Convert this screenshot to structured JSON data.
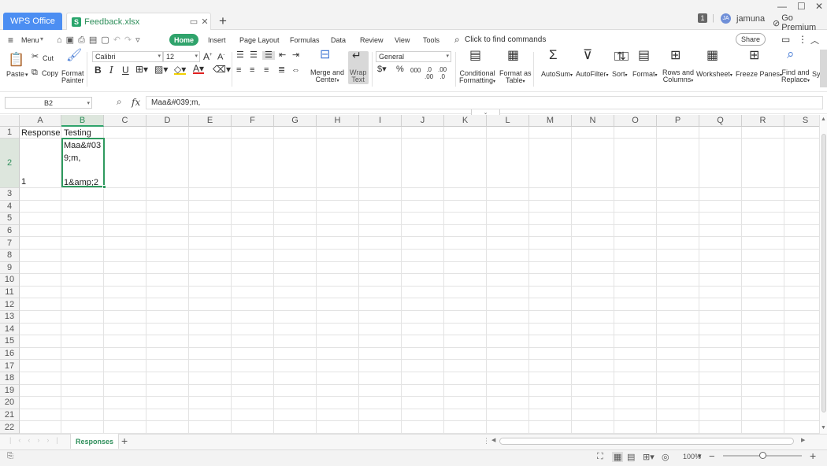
{
  "titlebar": {
    "app_tab": "WPS Office",
    "file_tab": "Feedback.xlsx",
    "file_icon_letter": "S",
    "badge_count": "1",
    "avatar_initials": "JA",
    "user": "jamuna",
    "premium": "Go Premium"
  },
  "menubar": {
    "menu_label": "Menu",
    "tabs": [
      "Home",
      "Insert",
      "Page Layout",
      "Formulas",
      "Data",
      "Review",
      "View",
      "Tools"
    ],
    "search": "Click to find commands",
    "share": "Share"
  },
  "ribbon": {
    "paste": "Paste",
    "cut": "Cut",
    "copy": "Copy",
    "format_painter_1": "Format",
    "format_painter_2": "Painter",
    "font_name": "Calibri",
    "font_size": "12",
    "merge_1": "Merge and",
    "merge_2": "Center",
    "wrap_1": "Wrap",
    "wrap_2": "Text",
    "number_format": "General",
    "cond_1": "Conditional",
    "cond_2": "Formatting",
    "table_1": "Format as",
    "table_2": "Table",
    "autosum": "AutoSum",
    "autofilter": "AutoFilter",
    "sort": "Sort",
    "format": "Format",
    "rows_1": "Rows and",
    "rows_2": "Columns",
    "worksheet": "Worksheet",
    "freeze": "Freeze Panes",
    "find_1": "Find and",
    "find_2": "Replace",
    "sym": "Sy"
  },
  "formula_bar": {
    "cell_ref": "B2",
    "fx": "fx",
    "content": "Maa&#039;m,"
  },
  "sheet": {
    "columns": [
      "A",
      "B",
      "C",
      "D",
      "E",
      "F",
      "G",
      "H",
      "I",
      "J",
      "K",
      "L",
      "M",
      "N",
      "O",
      "P",
      "Q",
      "R",
      "S"
    ],
    "rows": [
      "1",
      "2",
      "3",
      "4",
      "5",
      "6",
      "7",
      "8",
      "9",
      "10",
      "11",
      "12",
      "13",
      "14",
      "15",
      "16",
      "17",
      "18",
      "19",
      "20",
      "21",
      "22"
    ],
    "cells": {
      "A1": "Response",
      "B1": "Testing",
      "A2": "1",
      "B2": "Maa&#03\n9;m,\n\n1&amp;2"
    },
    "active_cell": "B2"
  },
  "sheet_tabs": {
    "active": "Responses",
    "add": "+"
  },
  "status": {
    "zoom": "100%"
  }
}
